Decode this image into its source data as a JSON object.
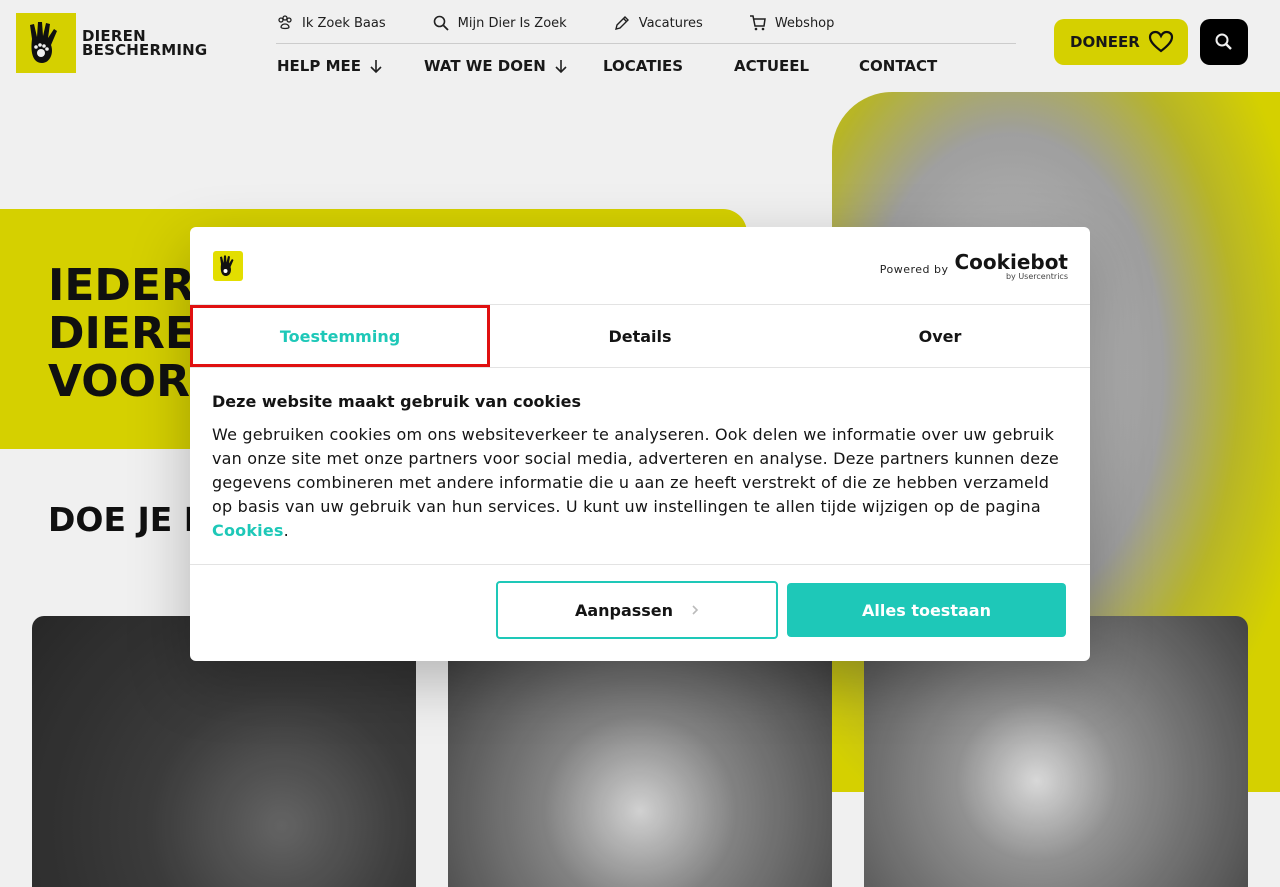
{
  "logo": {
    "line1": "DIEREN",
    "line2": "BESCHERMING"
  },
  "utility_nav": [
    {
      "label": "Ik Zoek Baas",
      "icon": "paw-icon"
    },
    {
      "label": "Mijn Dier Is Zoek",
      "icon": "search-icon"
    },
    {
      "label": "Vacatures",
      "icon": "pencil-icon"
    },
    {
      "label": "Webshop",
      "icon": "cart-icon"
    }
  ],
  "main_nav": [
    {
      "label": "HELP MEE",
      "has_arrow": true
    },
    {
      "label": "WAT WE DOEN",
      "has_arrow": true
    },
    {
      "label": "LOCATIES",
      "has_arrow": false
    },
    {
      "label": "ACTUEEL",
      "has_arrow": false
    },
    {
      "label": "CONTACT",
      "has_arrow": false
    }
  ],
  "donate": {
    "label": "DONEER",
    "icon": "heart-icon"
  },
  "search": {
    "icon": "search-icon"
  },
  "hero": {
    "line1": "IEDER",
    "line2": "DIERE",
    "line3": "VOORI"
  },
  "subtitle": "DOE JE M",
  "colors": {
    "brand_yellow": "#e3de00",
    "accent_teal": "#1ec8b8",
    "highlight_red": "#e01010"
  },
  "cookie_dialog": {
    "powered_by": "Powered by",
    "brand": "Cookiebot",
    "brand_sub": "by Usercentrics",
    "tabs": [
      {
        "label": "Toestemming",
        "active": true
      },
      {
        "label": "Details",
        "active": false
      },
      {
        "label": "Over",
        "active": false
      }
    ],
    "title": "Deze website maakt gebruik van cookies",
    "body": "We gebruiken cookies om ons websiteverkeer te analyseren. Ook delen we informatie over uw gebruik van onze site met onze partners voor social media, adverteren en analyse. Deze partners kunnen deze gegevens combineren met andere informatie die u aan ze heeft verstrekt of die ze hebben verzameld op basis van uw gebruik van hun services. U kunt uw instellingen te allen tijde wijzigen op de pagina ",
    "link": "Cookies",
    "period": ".",
    "btn_customize": "Aanpassen",
    "btn_allow": "Alles toestaan"
  }
}
